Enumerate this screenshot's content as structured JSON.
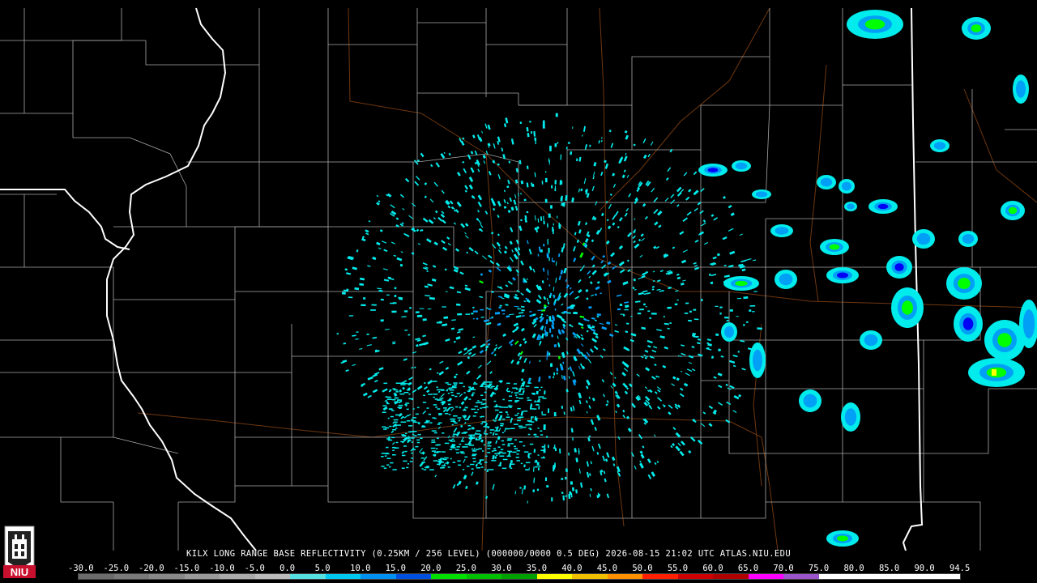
{
  "product": {
    "title": "KILX LONG RANGE BASE REFLECTIVITY (0.25KM / 256 LEVEL) (000000/0000 0.5 DEG) 2026-08-15 21:02 UTC  ATLAS.NIU.EDU"
  },
  "logo": {
    "text": "NIU",
    "color": "#c8102e"
  },
  "map": {
    "background": "#000000",
    "county_line_color": "#b4b4b4",
    "state_line_color": "#ffffff",
    "road_color": "#a0522d",
    "echo_colors": [
      "#00ecec",
      "#01a0f6",
      "#0000f6",
      "#00ff00",
      "#00c800",
      "#ffff00"
    ]
  },
  "color_scale": {
    "labels": [
      "-30.0",
      "-25.0",
      "-20.0",
      "-15.0",
      "-10.0",
      "-5.0",
      "0.0",
      "5.0",
      "10.0",
      "15.0",
      "20.0",
      "25.0",
      "30.0",
      "35.0",
      "40.0",
      "45.0",
      "50.0",
      "55.0",
      "60.0",
      "65.0",
      "70.0",
      "75.0",
      "80.0",
      "85.0",
      "90.0",
      "94.5"
    ],
    "colors": [
      "#6b6b6b",
      "#7a7a7a",
      "#898989",
      "#9a9a9a",
      "#ababab",
      "#bcbcbc",
      "#56e0e0",
      "#00c8f0",
      "#0090f0",
      "#0050e0",
      "#00e000",
      "#00c000",
      "#00a000",
      "#ffff00",
      "#f0c000",
      "#ff9000",
      "#ff2000",
      "#d00000",
      "#b00000",
      "#ff00ff",
      "#9955c9",
      "#ffffff",
      "#ffffff",
      "#ffffff",
      "#ffffff"
    ]
  }
}
